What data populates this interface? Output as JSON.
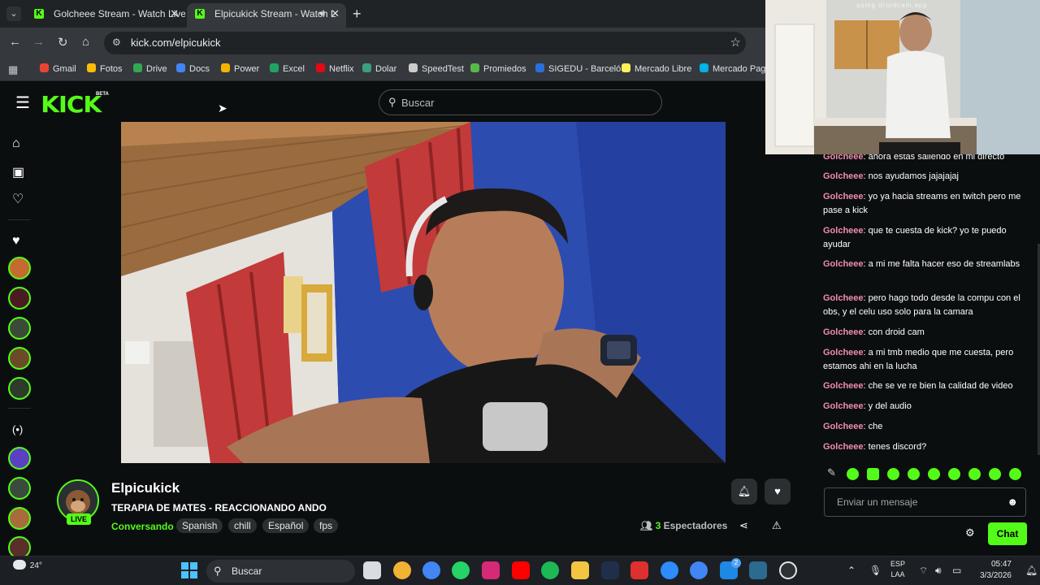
{
  "browser": {
    "tabs": [
      {
        "title": "Golcheee Stream - Watch Live o",
        "active": false
      },
      {
        "title": "Elpicukick Stream - Watch L",
        "active": true
      }
    ],
    "url": "kick.com/elpicukick",
    "bookmarks": [
      {
        "label": "Gmail",
        "color": "#ea4335"
      },
      {
        "label": "Fotos",
        "color": "#fbbc04"
      },
      {
        "label": "Drive",
        "color": "#34a853"
      },
      {
        "label": "Docs",
        "color": "#4285f4"
      },
      {
        "label": "Power",
        "color": "#f4b400"
      },
      {
        "label": "Excel",
        "color": "#21a366"
      },
      {
        "label": "Netflix",
        "color": "#e50914"
      },
      {
        "label": "Dolar",
        "color": "#3aa17e"
      },
      {
        "label": "SpeedTest",
        "color": "#cccccc"
      },
      {
        "label": "Promiedos",
        "color": "#57b947"
      },
      {
        "label": "SIGEDU - Barceló",
        "color": "#2a6fdb"
      },
      {
        "label": "Mercado Libre",
        "color": "#fff159"
      },
      {
        "label": "Mercado Pago",
        "color": "#00b1ea"
      }
    ]
  },
  "kick": {
    "logo": "KICK",
    "beta": "BETA",
    "search_placeholder": "Buscar",
    "accent": "#53fc18"
  },
  "stream": {
    "channel": "Elpicukick",
    "live_label": "LIVE",
    "title": "TERAPIA DE MATES - REACCIONANDO ANDO",
    "category": "Conversando",
    "tags": [
      "Spanish",
      "chill",
      "Español",
      "fps"
    ],
    "viewer_count": "3",
    "viewer_label": "Espectadores"
  },
  "chat": {
    "messages": [
      {
        "user": "Golcheee",
        "text": "ahora estas saliendo en mi directo"
      },
      {
        "user": "Golcheee",
        "text": "nos ayudamos jajajajaj"
      },
      {
        "user": "Golcheee",
        "text": "yo ya hacia streams en twitch pero me pase a kick"
      },
      {
        "user": "Golcheee",
        "text": "que te cuesta de kick? yo te puedo ayudar"
      },
      {
        "user": "Golcheee",
        "text": "a mi me falta hacer eso de streamlabs"
      },
      {
        "user": "Golcheee",
        "text": "pero hago todo desde la compu con el obs, y el celu uso solo para la camara"
      },
      {
        "user": "Golcheee",
        "text": "con droid cam"
      },
      {
        "user": "Golcheee",
        "text": "a mi tmb medio que me cuesta, pero estamos ahi en la lucha"
      },
      {
        "user": "Golcheee",
        "text": "che se ve re bien la calidad de video"
      },
      {
        "user": "Golcheee",
        "text": "y del audio"
      },
      {
        "user": "Golcheee",
        "text": "che"
      },
      {
        "user": "Golcheee",
        "text": "tenes discord?"
      }
    ],
    "input_placeholder": "Enviar un mensaje",
    "send_label": "Chat"
  },
  "webcam": {
    "watermark": "using droidcam.app"
  },
  "taskbar": {
    "temperature": "24°",
    "search_placeholder": "Buscar",
    "lang_line1": "ESP",
    "lang_line2": "LAA",
    "time": "05:47",
    "date": "3/3/2026",
    "store_badge": "2"
  }
}
